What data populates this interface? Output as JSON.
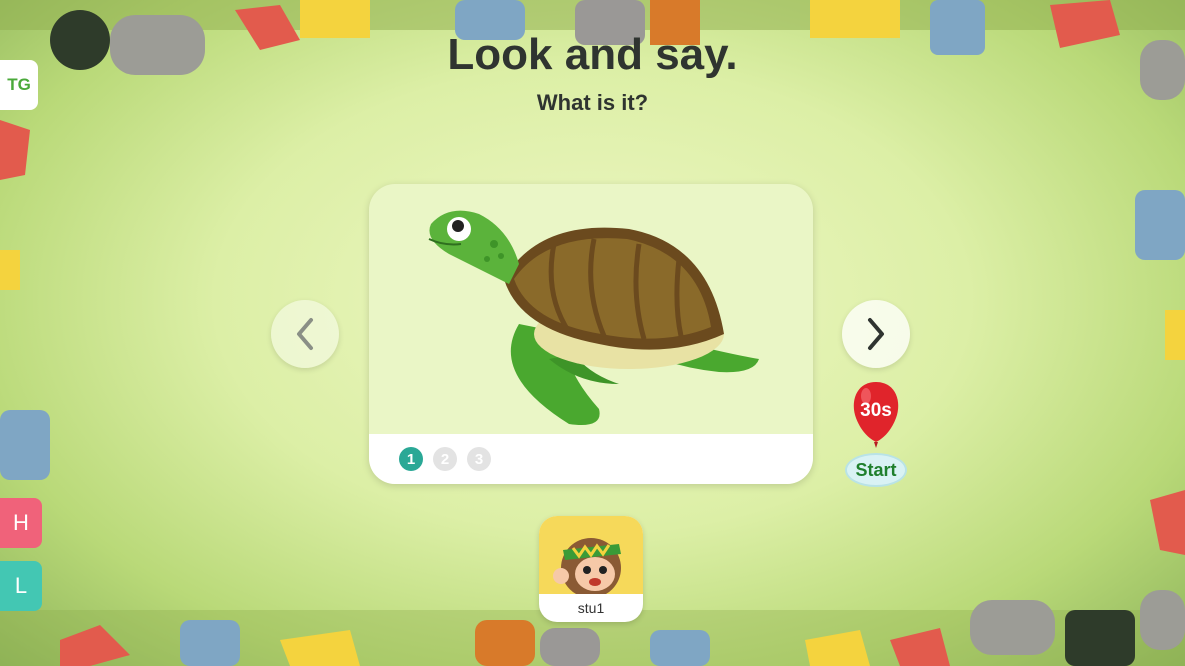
{
  "header": {
    "title": "Look and say.",
    "subtitle": "What is it?"
  },
  "side_tabs": {
    "tg": "TG",
    "h": "H",
    "l": "L"
  },
  "card": {
    "image": "turtle-illustration",
    "pages": [
      "1",
      "2",
      "3"
    ],
    "active_page": "1"
  },
  "timer": {
    "label": "30s",
    "start_label": "Start"
  },
  "student": {
    "name": "stu1",
    "avatar": "monkey-avatar"
  },
  "icons": {
    "prev": "chevron-left-icon",
    "next": "chevron-right-icon"
  },
  "colors": {
    "accent": "#2aa896",
    "tab_h": "#f0627a",
    "tab_l": "#43c7b3",
    "balloon": "#e0242b"
  }
}
